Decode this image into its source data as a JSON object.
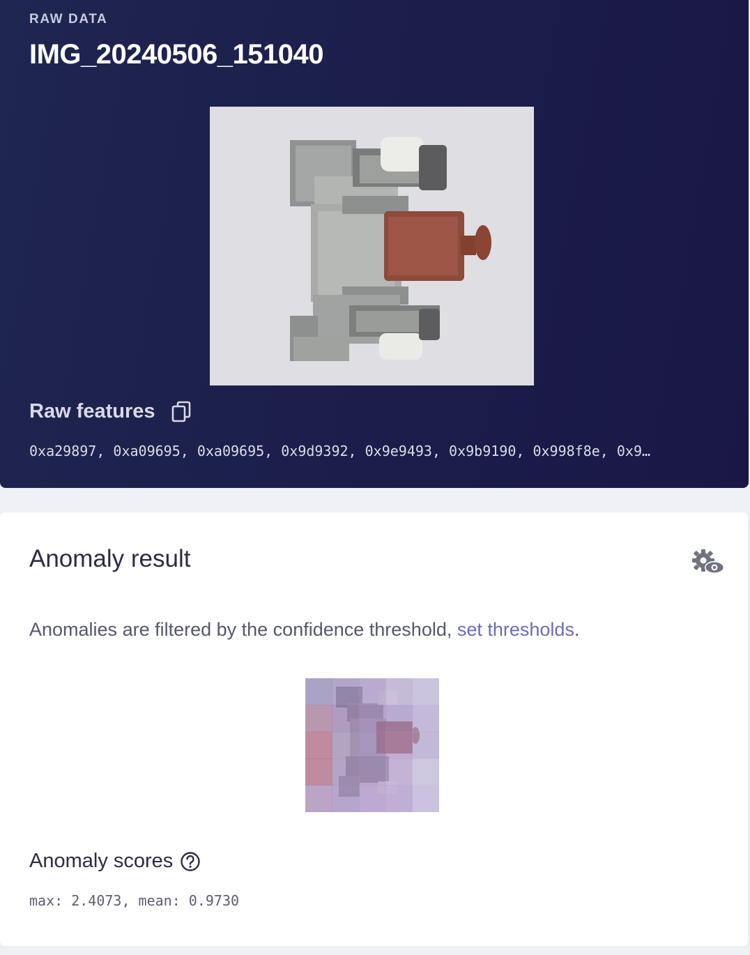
{
  "raw_data": {
    "eyebrow": "RAW DATA",
    "sample_name": "IMG_20240506_151040",
    "features_heading": "Raw features",
    "features_values": "0xa29897, 0xa09695, 0xa09695, 0x9d9392, 0x9e9493, 0x9b9190, 0x998f8e, 0x9…"
  },
  "anomaly": {
    "title": "Anomaly result",
    "filter_text": "Anomalies are filtered by the confidence threshold, ",
    "filter_link": "set thresholds",
    "filter_end": ".",
    "scores_heading": "Anomaly scores",
    "scores_text": "max: 2.4073, mean: 0.9730",
    "heatmap_colors": [
      [
        "#8f82b8",
        "#9c88c0",
        "#a48ec8",
        "#b9a9d6",
        "#c4b8de"
      ],
      [
        "#a86f95",
        "#9a78ad",
        "#a382c0",
        "#a78ec9",
        "#b8a7d6"
      ],
      [
        "#b05c78",
        "#9d86b2",
        "#a487c4",
        "#b193cc",
        "#b5a4d3"
      ],
      [
        "#b05c78",
        "#a184b8",
        "#a98ac3",
        "#b89dd0",
        "#c6bde0"
      ],
      [
        "#ab84b8",
        "#a288c2",
        "#ae8ccb",
        "#b296d0",
        "#c2b5de"
      ]
    ]
  }
}
